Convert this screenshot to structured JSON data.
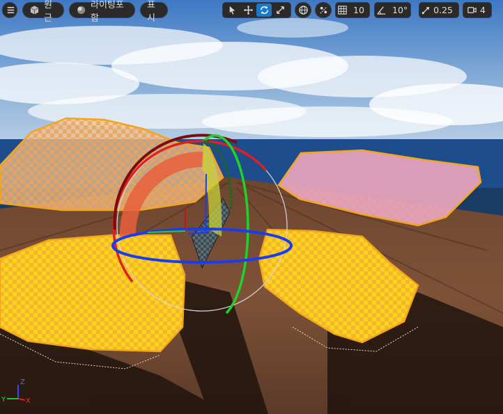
{
  "toolbar": {
    "perspective_label": "원근",
    "lit_label": "라이팅포함",
    "show_label": "표시",
    "grid_snap_value": "10",
    "rotation_snap_value": "10°",
    "scale_snap_value": "0.25",
    "camera_speed_value": "4"
  },
  "axis_labels": {
    "z": "Z",
    "y": "Y",
    "x": "X"
  },
  "colors": {
    "selection_outline": "#f3a51c",
    "selected_fill": "#ffd21e",
    "active_tool": "#1e78c8",
    "axis_x": "#e0201c",
    "axis_y": "#22d22a",
    "axis_z": "#1a3cf0"
  },
  "icons": {
    "menu": "hamburger-icon",
    "perspective": "cube-icon",
    "lit": "sphere-icon",
    "select": "cursor-arrow-icon",
    "translate": "move-arrows-icon",
    "rotate": "rotate-arrows-icon",
    "scale": "scale-arrows-icon",
    "world": "globe-icon",
    "surface_snap": "surface-snap-icon",
    "grid": "grid-icon",
    "angle": "angle-icon",
    "scale_snap": "diagonal-arrow-icon",
    "camera": "video-camera-icon"
  }
}
